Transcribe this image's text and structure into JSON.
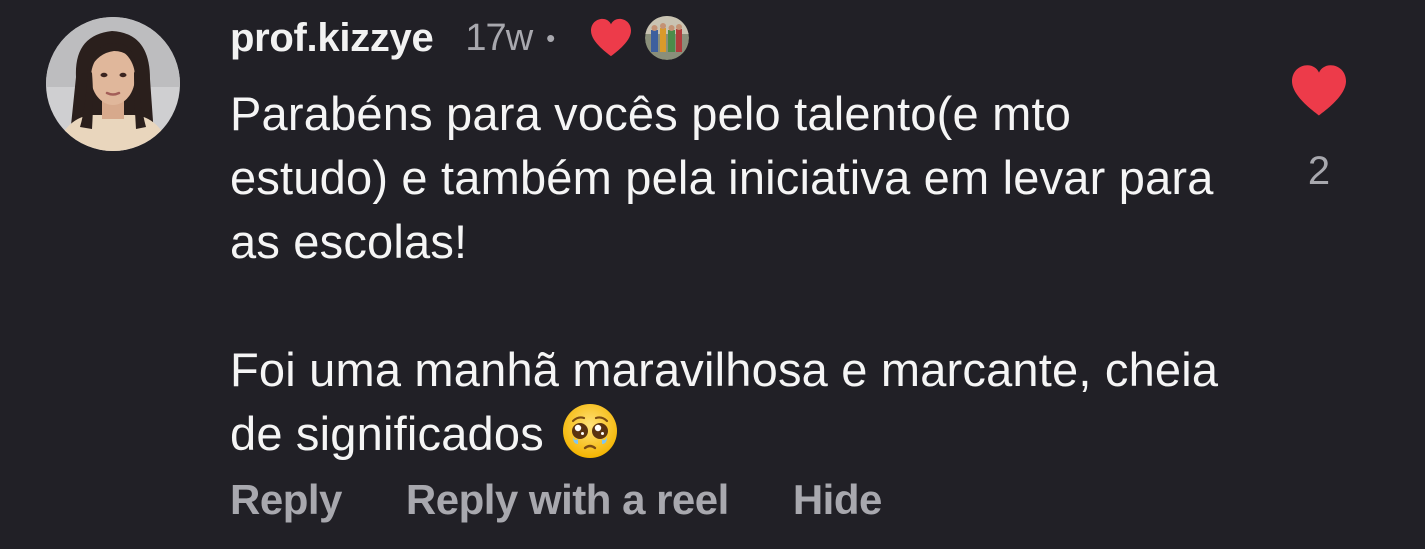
{
  "comment": {
    "username": "prof.kizzye",
    "timestamp": "17w",
    "separator": "•",
    "creator_liked_icon": "heart-icon",
    "paragraph_1": "Parabéns para vocês pelo talento(e mto estudo) e também pela iniciativa em levar para as escolas!",
    "paragraph_2": "Foi uma manhã maravilhosa e marcante, cheia de significados",
    "emoji": "pleading-face-icon"
  },
  "like": {
    "icon": "heart-icon",
    "count": "2",
    "color": "#ED3B4A"
  },
  "actions": {
    "reply": "Reply",
    "reply_with_reel": "Reply with a reel",
    "hide": "Hide"
  },
  "colors": {
    "background": "#212026",
    "text_primary": "#F5F5F5",
    "text_secondary": "#A8A8AE",
    "heart": "#ED3B4A"
  }
}
